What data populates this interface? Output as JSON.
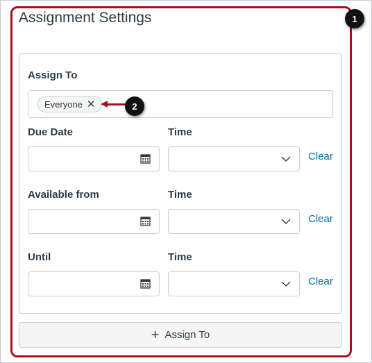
{
  "title": "Assignment Settings",
  "assign_to": {
    "label": "Assign To",
    "tags": [
      "Everyone"
    ],
    "remove_icon": "close-icon"
  },
  "rows": [
    {
      "date_label": "Due Date",
      "time_label": "Time",
      "clear_label": "Clear"
    },
    {
      "date_label": "Available from",
      "time_label": "Time",
      "clear_label": "Clear"
    },
    {
      "date_label": "Until",
      "time_label": "Time",
      "clear_label": "Clear"
    }
  ],
  "add_button": {
    "label": "Assign To",
    "icon": "plus-icon"
  },
  "callouts": [
    "1",
    "2"
  ],
  "colors": {
    "highlight": "#a70f1f",
    "link": "#0770a3",
    "text": "#2d3b45",
    "border": "#c7cdd1"
  }
}
